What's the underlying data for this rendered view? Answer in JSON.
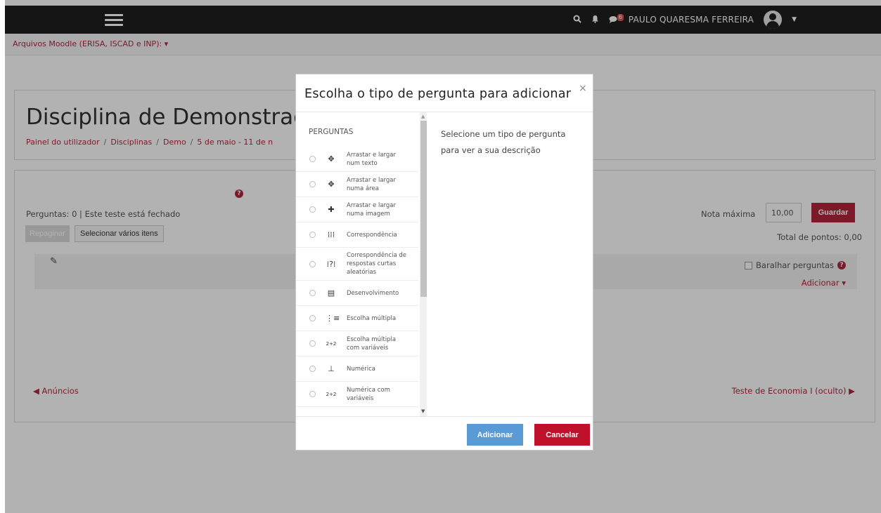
{
  "topbar": {
    "user_name": "PAULO QUARESMA FERREIRA",
    "messages_badge": "6",
    "icons": [
      "menu-icon",
      "search-icon",
      "bell-icon",
      "chat-icon",
      "avatar",
      "caret-down-icon"
    ],
    "background": "#1f1f1f"
  },
  "sitebar": {
    "link": "Arquivos Moodle (ERISA, ISCAD e INP): ▾"
  },
  "header": {
    "title": "Disciplina de Demonstraçã",
    "breadcrumb": [
      "Painel do utilizador",
      "Disciplinas",
      "Demo",
      "5 de maio - 11 de n"
    ]
  },
  "quiz": {
    "status": "Perguntas: 0 | Este teste está fechado",
    "repaginate_label": "Repaginar",
    "select_multiple_label": "Selecionar vários itens",
    "max_grade_label": "Nota máxima",
    "max_grade_value": "10,00",
    "save_label": "Guardar",
    "total_points": "Total de pontos: 0,00",
    "shuffle_label": "Baralhar perguntas",
    "add_label": "Adicionar ▾",
    "prev_link": "◀ Anúncios",
    "next_link": "Teste de Economia I (oculto) ▶"
  },
  "modal": {
    "title": "Escolha o tipo de pergunta para adicionar",
    "close": "×",
    "types_heading": "PERGUNTAS",
    "description": "Selecione um tipo de pergunta para ver a sua descrição",
    "add_label": "Adicionar",
    "cancel_label": "Cancelar",
    "question_types": [
      {
        "name": "Arrastar e largar num texto",
        "icon": "drag-text-icon",
        "glyph": "✥"
      },
      {
        "name": "Arrastar e largar numa área",
        "icon": "drag-area-icon",
        "glyph": "✥"
      },
      {
        "name": "Arrastar e largar numa imagem",
        "icon": "drag-image-icon",
        "glyph": "✚"
      },
      {
        "name": "Correspondência",
        "icon": "matching-icon",
        "glyph": "⁞⁞⁞"
      },
      {
        "name": "Correspondência de respostas curtas aleatórias",
        "icon": "random-match-icon",
        "glyph": "⁞?⁞"
      },
      {
        "name": "Desenvolvimento",
        "icon": "essay-icon",
        "glyph": "▤"
      },
      {
        "name": "Escolha múltipla",
        "icon": "multichoice-icon",
        "glyph": "⋮≡"
      },
      {
        "name": "Escolha múltipla com variáveis",
        "icon": "calc-multichoice-icon",
        "glyph": "2+2"
      },
      {
        "name": "Numérica",
        "icon": "numerical-icon",
        "glyph": "⊥"
      },
      {
        "name": "Numérica com variáveis",
        "icon": "calculated-icon",
        "glyph": "2+2"
      }
    ]
  }
}
